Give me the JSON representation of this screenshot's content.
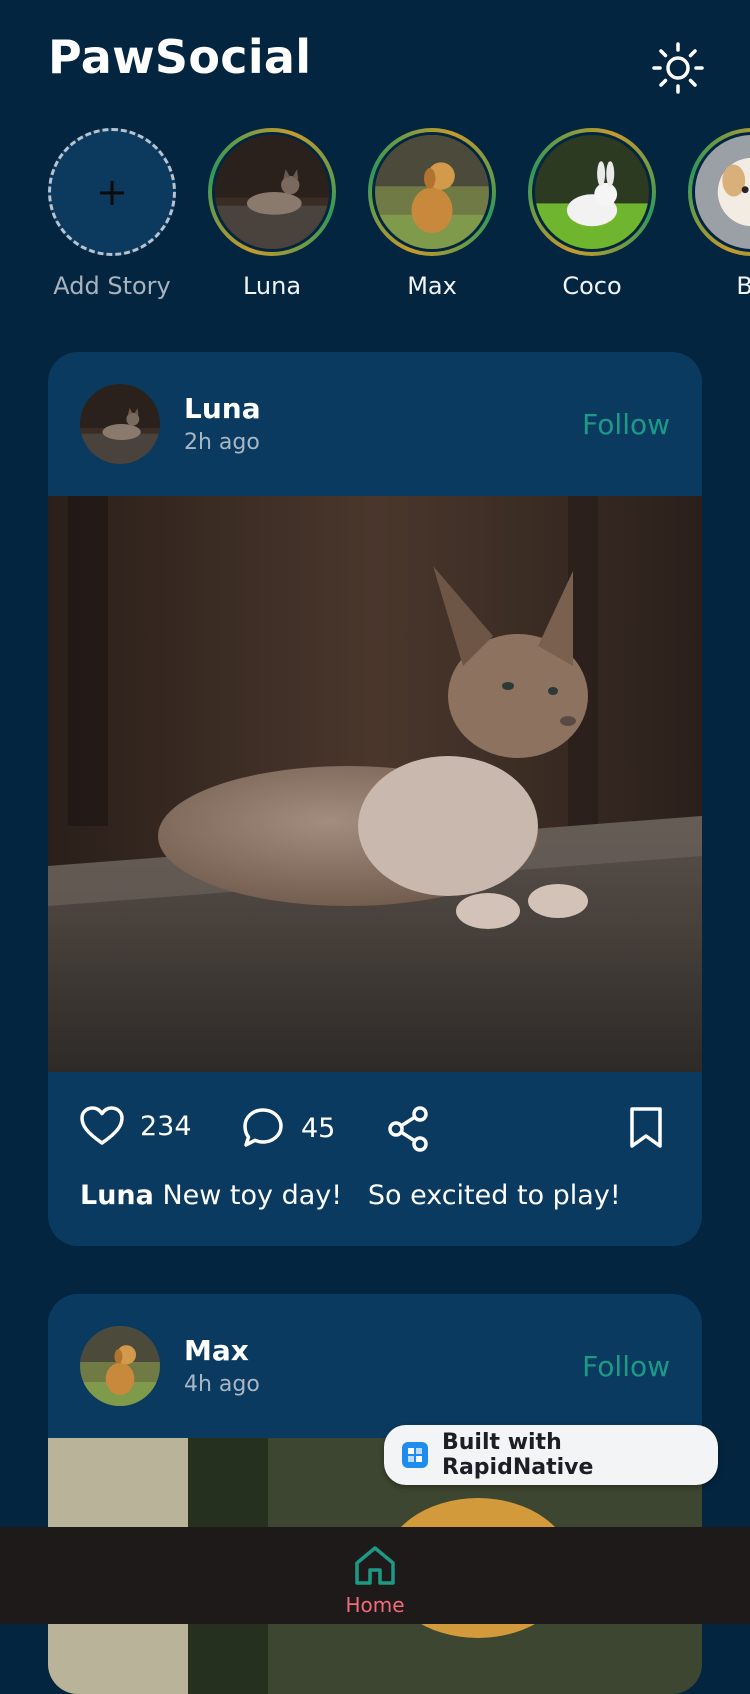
{
  "header": {
    "title": "PawSocial",
    "theme_icon": "sun-icon"
  },
  "stories": {
    "add_label": "Add Story",
    "items": [
      {
        "name": "Luna",
        "image": "cat-photo"
      },
      {
        "name": "Max",
        "image": "golden-retriever-photo"
      },
      {
        "name": "Coco",
        "image": "white-rabbit-photo"
      },
      {
        "name": "Be",
        "image": "dog-photo"
      }
    ]
  },
  "posts": [
    {
      "author": "Luna",
      "time": "2h ago",
      "follow_label": "Follow",
      "likes": "234",
      "comments": "45",
      "caption_author": "Luna",
      "caption_text": " New toy day!   So excited to play!"
    },
    {
      "author": "Max",
      "time": "4h ago",
      "follow_label": "Follow"
    }
  ],
  "badge": {
    "label": "Built with RapidNative"
  },
  "nav": {
    "home_label": "Home"
  },
  "colors": {
    "background": "#03253f",
    "card": "#0a3a60",
    "accent": "#1d9a86",
    "nav_active_label": "#f06c7c"
  }
}
